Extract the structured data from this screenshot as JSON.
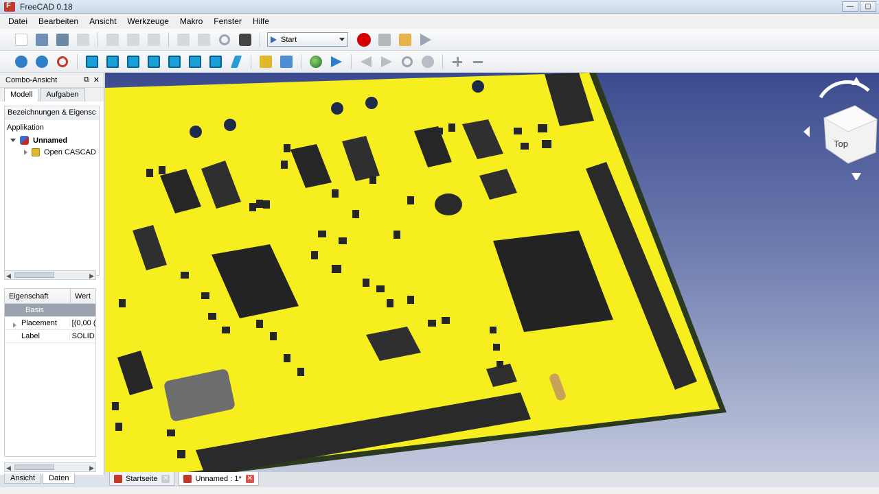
{
  "window": {
    "title": "FreeCAD 0.18"
  },
  "menu": [
    "Datei",
    "Bearbeiten",
    "Ansicht",
    "Werkzeuge",
    "Makro",
    "Fenster",
    "Hilfe"
  ],
  "toolbar": {
    "workbench": "Start"
  },
  "combo": {
    "title": "Combo-Ansicht",
    "tabs": [
      "Modell",
      "Aufgaben"
    ],
    "tree_header": "Bezeichnungen & Eigensc",
    "tree": {
      "root": "Applikation",
      "document": "Unnamed",
      "part": "Open CASCAD"
    },
    "properties": {
      "header": [
        "Eigenschaft",
        "Wert"
      ],
      "group": "Basis",
      "rows": [
        {
          "name": "Placement",
          "value": "[(0,00 ("
        },
        {
          "name": "Label",
          "value": "SOLID"
        }
      ]
    },
    "bottom_tabs": [
      "Ansicht",
      "Daten"
    ]
  },
  "navcube": {
    "face": "Top"
  },
  "doc_tabs": [
    "Startseite",
    "Unnamed : 1*"
  ],
  "colors": {
    "board": "#f6ee1f",
    "background_top": "#3b4b8e",
    "component": "#232323"
  }
}
